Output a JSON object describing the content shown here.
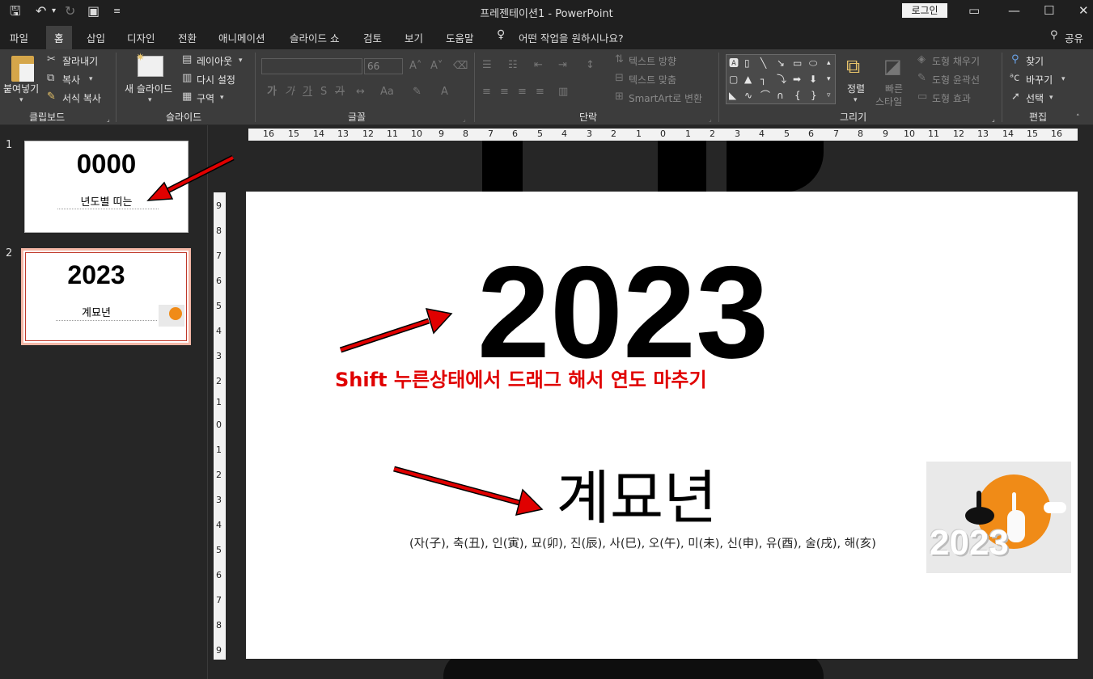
{
  "window": {
    "title": "프레젠테이션1  -  PowerPoint",
    "login_label": "로그인"
  },
  "tabs": [
    "파일",
    "홈",
    "삽입",
    "디자인",
    "전환",
    "애니메이션",
    "슬라이드 쇼",
    "검토",
    "보기",
    "도움말"
  ],
  "active_tab": "홈",
  "tellme": "어떤 작업을 원하시나요?",
  "share": "공유",
  "ribbon": {
    "clipboard": {
      "paste": "붙여넣기",
      "cut": "잘라내기",
      "copy": "복사",
      "format_painter": "서식 복사",
      "group": "클립보드"
    },
    "slides": {
      "new_slide": "새 슬라이드",
      "layout": "레이아웃",
      "reset": "다시 설정",
      "section": "구역",
      "group": "슬라이드"
    },
    "font": {
      "size": "66",
      "group": "글꼴"
    },
    "paragraph": {
      "text_direction": "텍스트 방향",
      "align_text": "텍스트 맞춤",
      "smartart": "SmartArt로 변환",
      "group": "단락"
    },
    "drawing": {
      "arrange": "정렬",
      "quick_styles_1": "빠른",
      "quick_styles_2": "스타일",
      "shape_fill": "도형 채우기",
      "shape_outline": "도형 윤곽선",
      "shape_effects": "도형 효과",
      "group": "그리기"
    },
    "editing": {
      "find": "찾기",
      "replace": "바꾸기",
      "select": "선택",
      "group": "편집"
    }
  },
  "thumbnails": [
    {
      "number": "1",
      "year": "0000",
      "subtitle": "년도별 띠는"
    },
    {
      "number": "2",
      "year": "2023",
      "subtitle": "계묘년"
    }
  ],
  "slide": {
    "year": "2023",
    "annotation": "Shift 누른상태에서 드래그 해서 연도 마추기",
    "subtitle": "계묘년",
    "zodiac": "(자(子), 축(丑), 인(寅), 묘(卯), 진(辰), 사(巳), 오(午), 미(未), 신(申), 유(酉), 술(戌), 해(亥)",
    "picture_year": "2023"
  },
  "ruler": {
    "horizontal": [
      "16",
      "15",
      "14",
      "13",
      "12",
      "11",
      "10",
      "9",
      "8",
      "7",
      "6",
      "5",
      "4",
      "3",
      "2",
      "1",
      "0",
      "1",
      "2",
      "3",
      "4",
      "5",
      "6",
      "7",
      "8",
      "9",
      "10",
      "11",
      "12",
      "13",
      "14",
      "15",
      "16"
    ],
    "vertical": [
      "9",
      "8",
      "7",
      "6",
      "5",
      "4",
      "3",
      "2",
      "1",
      "0",
      "1",
      "2",
      "3",
      "4",
      "5",
      "6",
      "7",
      "8",
      "9"
    ]
  },
  "colors": {
    "accent_red": "#e00000",
    "ribbon_bg": "#3c3c3c",
    "titlebar_bg": "#1f1f1f",
    "selected_thumb_border": "#f4b7a6"
  },
  "icons": [
    "save-icon",
    "undo-icon",
    "redo-icon",
    "slideshow-icon",
    "lightbulb-icon",
    "person-icon",
    "scissors-icon",
    "copy-icon",
    "format-painter-icon",
    "find-icon",
    "replace-icon",
    "select-icon"
  ]
}
